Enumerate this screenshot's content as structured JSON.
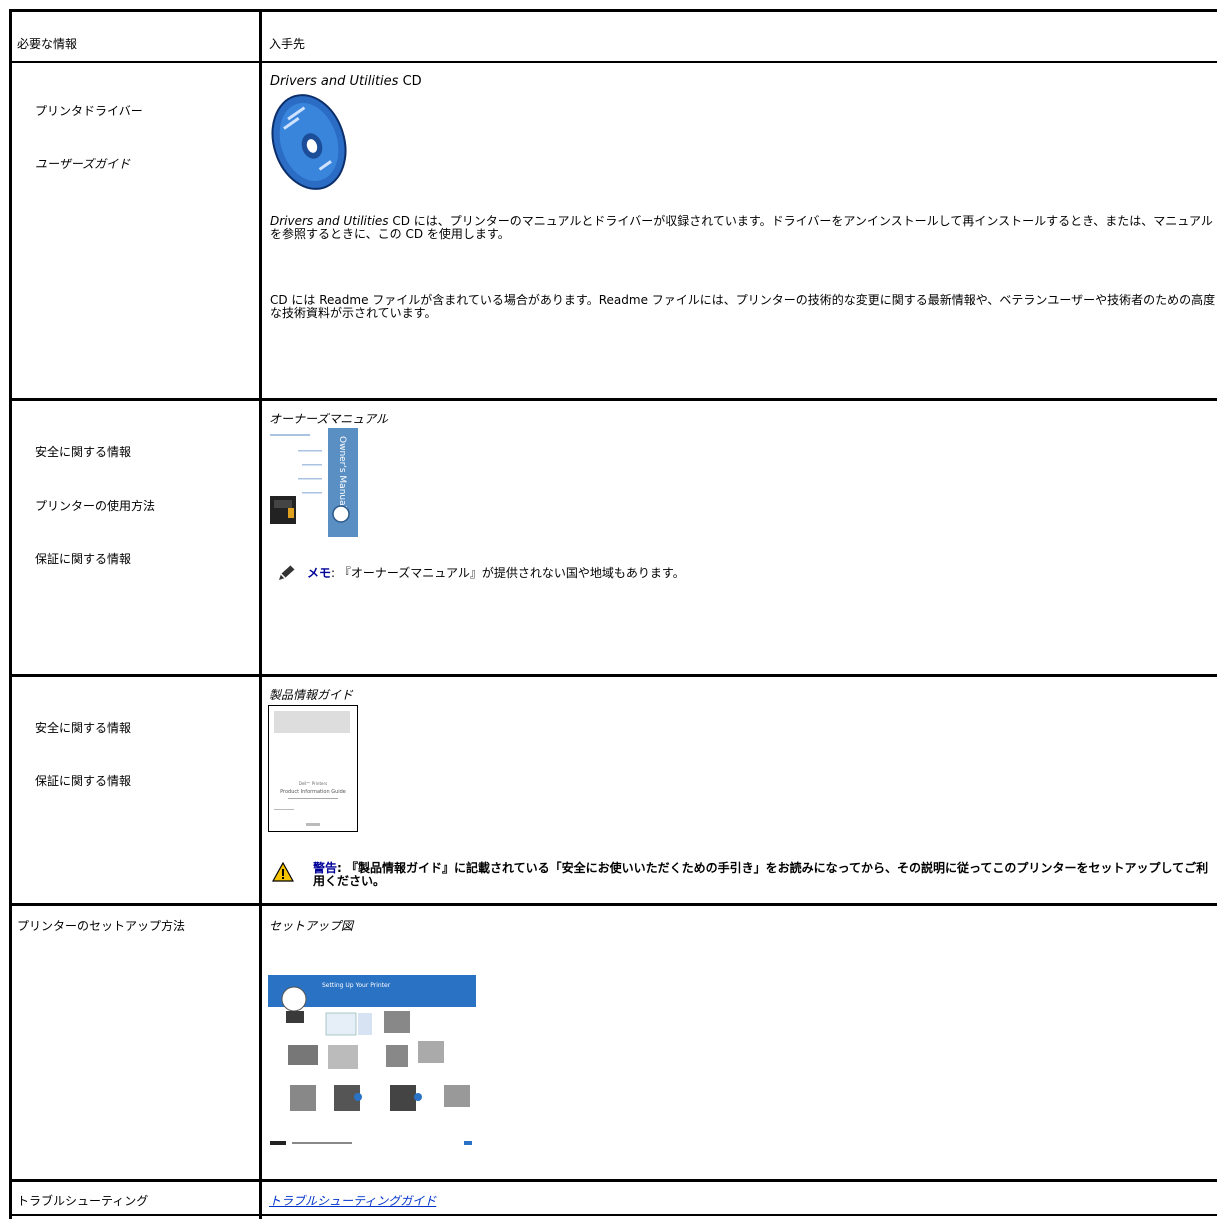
{
  "table": {
    "header": {
      "col1": "必要な情報",
      "col2": "入手先"
    },
    "rows": [
      {
        "left": [
          "プリンタドライバー",
          "ユーザーズガイド"
        ],
        "source_title_italic": "Drivers and Utilities",
        "source_title_rest": " CD",
        "image_icon": "cd-disc-icon",
        "para1_italic": "Drivers and Utilities",
        "para1_rest": " CD には、プリンターのマニュアルとドライバーが収録されています。ドライバーをアンインストールして再インストールするとき、または、マニュアルを参照するときに、この CD を使用します。",
        "para2": "CD には Readme ファイルが含まれている場合があります。Readme ファイルには、プリンターの技術的な変更に関する最新情報や、ベテランユーザーや技術者のための高度な技術資料が示されています。"
      },
      {
        "left": [
          "安全に関する情報",
          "プリンターの使用方法",
          "保証に関する情報"
        ],
        "source_title": "オーナーズマニュアル",
        "image_icon": "owners-manual-cover-icon",
        "image_text": "Owner's Manual",
        "note_icon": "note-pencil-icon",
        "note_label": "メモ",
        "note_text": ": 『オーナーズマニュアル』が提供されない国や地域もあります。"
      },
      {
        "left": [
          "安全に関する情報",
          "保証に関する情報"
        ],
        "source_title": "製品情報ガイド",
        "image_icon": "product-info-guide-cover-icon",
        "image_text_1": "Dell™ Printers",
        "image_text_2": "Product Information Guide",
        "warning_icon": "warning-triangle-icon",
        "warning_label": "警告",
        "warning_text": ": 『製品情報ガイド』に記載されている「安全にお使いいただくための手引き」をお読みになってから、その説明に従ってこのプリンターをセットアップしてご利用ください。"
      },
      {
        "left": [
          "プリンターのセットアップ方法"
        ],
        "source_title": "セットアップ図",
        "image_icon": "setup-diagram-icon",
        "image_text": "Setting Up Your Printer"
      },
      {
        "left": [
          "トラブルシューティング"
        ],
        "source_link": "トラブルシューティングガイド"
      }
    ]
  },
  "colors": {
    "link": "#0033cc",
    "note_label": "#000099",
    "warning_yellow": "#f5c400"
  }
}
